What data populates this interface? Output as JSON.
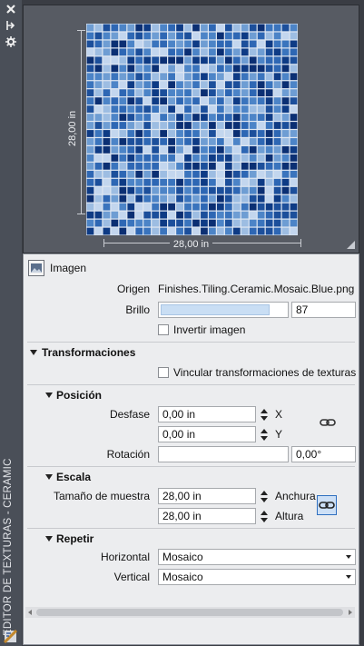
{
  "sidebar": {
    "title": "EDITOR DE TEXTURAS - CERAMIC",
    "icons": [
      "close-icon",
      "pin-icon",
      "settings-icon",
      "texture-editor-icon"
    ]
  },
  "preview": {
    "width_label": "28,00 in",
    "height_label": "28,00 in",
    "mosaic_colors": [
      "#0b2f73",
      "#1c4f9b",
      "#2e67b4",
      "#4c84c7",
      "#6e9dd3",
      "#9dbde2",
      "#c3d6ee",
      "#0e3b85",
      "#3a74bd"
    ]
  },
  "image_section": {
    "header": "Imagen",
    "source_label": "Origen",
    "source_value": "Finishes.Tiling.Ceramic.Mosaic.Blue.png",
    "brightness_label": "Brillo",
    "brightness_value": "87",
    "brightness_fraction": 0.87,
    "invert_label": "Invertir imagen",
    "invert_checked": false
  },
  "transforms": {
    "header": "Transformaciones",
    "link_label": "Vincular transformaciones de texturas",
    "link_checked": false,
    "position": {
      "header": "Posición",
      "offset_label": "Desfase",
      "offset_x": "0,00 in",
      "offset_y": "0,00 in",
      "x_axis": "X",
      "y_axis": "Y",
      "rotation_label": "Rotación",
      "rotation_value": "0,00°"
    },
    "scale": {
      "header": "Escala",
      "sample_size_label": "Tamaño de muestra",
      "width_value": "28,00 in",
      "height_value": "28,00 in",
      "width_unit": "Anchura",
      "height_unit": "Altura"
    },
    "repeat": {
      "header": "Repetir",
      "horizontal_label": "Horizontal",
      "horizontal_value": "Mosaico",
      "vertical_label": "Vertical",
      "vertical_value": "Mosaico"
    }
  }
}
